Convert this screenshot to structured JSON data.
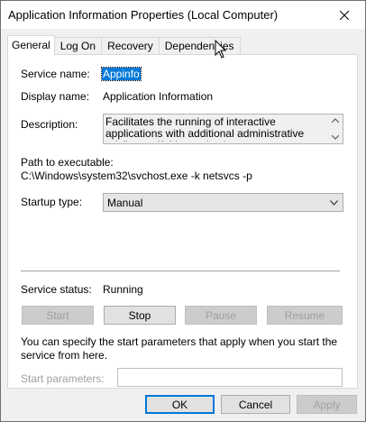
{
  "window": {
    "title": "Application Information Properties (Local Computer)",
    "close_icon": "close-icon"
  },
  "tabs": [
    {
      "label": "General",
      "active": true
    },
    {
      "label": "Log On",
      "active": false
    },
    {
      "label": "Recovery",
      "active": false
    },
    {
      "label": "Dependencies",
      "active": false
    }
  ],
  "general": {
    "service_name_label": "Service name:",
    "service_name_value": "Appinfo",
    "display_name_label": "Display name:",
    "display_name_value": "Application Information",
    "description_label": "Description:",
    "description_value": "Facilitates the running of interactive applications with additional administrative privileges.  If this service is",
    "path_label": "Path to executable:",
    "path_value": "C:\\Windows\\system32\\svchost.exe -k netsvcs -p",
    "startup_type_label": "Startup type:",
    "startup_type_value": "Manual",
    "service_status_label": "Service status:",
    "service_status_value": "Running",
    "start_button": "Start",
    "stop_button": "Stop",
    "pause_button": "Pause",
    "resume_button": "Resume",
    "params_help": "You can specify the start parameters that apply when you start the service from here.",
    "start_params_label": "Start parameters:",
    "start_params_value": ""
  },
  "footer": {
    "ok_button": "OK",
    "cancel_button": "Cancel",
    "apply_button": "Apply"
  },
  "colors": {
    "selection": "#0078d7",
    "dialog_bg": "#f0f0f0",
    "disabled_text": "#a0a0a0"
  }
}
